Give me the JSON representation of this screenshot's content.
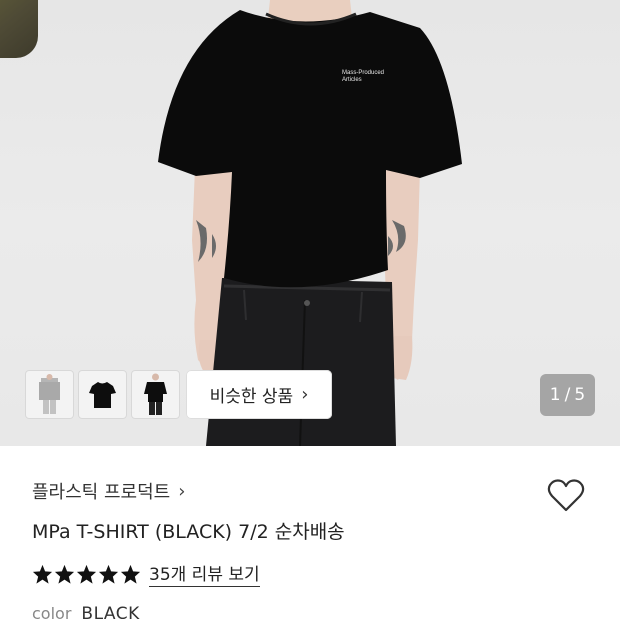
{
  "product": {
    "brand": "플라스틱 프로덕트",
    "title": "MPa T-SHIRT (BLACK) 7/2 순차배송",
    "reviews_label": "35개 리뷰 보기",
    "rating_stars": 5,
    "shirt_print": [
      "Mass-Produced",
      "Articles"
    ]
  },
  "gallery": {
    "similar_button_label": "비슷한 상품",
    "pager_current": "1",
    "pager_separator": "/",
    "pager_total": "5"
  },
  "options": {
    "color_label": "color",
    "color_value": "BLACK"
  },
  "icons": {
    "heart": "heart-outline-icon",
    "chevron": "chevron-right-icon",
    "star": "star-filled-icon"
  },
  "colors": {
    "shirt": "#0b0b0b",
    "star": "#111111",
    "pager_bg": "#6e6e6e"
  }
}
